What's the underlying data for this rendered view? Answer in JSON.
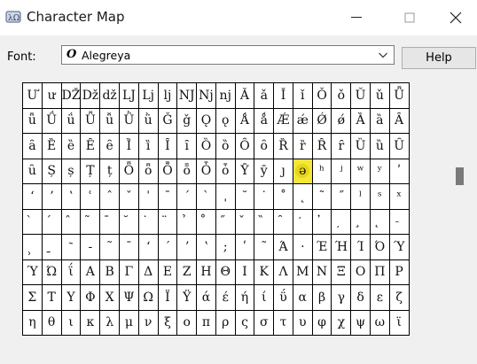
{
  "window": {
    "title": "Character Map"
  },
  "font": {
    "label": "Font:",
    "value": "Alegreya",
    "glyph": "O"
  },
  "help_label": "Help",
  "grid": {
    "rows": [
      [
        "Ư",
        "ư",
        "DŽ",
        "Dž",
        "dž",
        "LJ",
        "Lj",
        "lj",
        "NJ",
        "Nj",
        "nj",
        "Ǎ",
        "ǎ",
        "Ǐ",
        "ǐ",
        "Ǒ",
        "ǒ",
        "Ǔ",
        "ǔ",
        "Ǖ"
      ],
      [
        "ǖ",
        "Ǘ",
        "ǘ",
        "Ǚ",
        "ǚ",
        "Ǜ",
        "ǜ",
        "Ǧ",
        "ǧ",
        "Ǫ",
        "ǫ",
        "Ǻ",
        "ǻ",
        "Ǽ",
        "ǽ",
        "Ǿ",
        "ǿ",
        "Ȁ",
        "ȁ",
        "Ȃ"
      ],
      [
        "ȃ",
        "Ȅ",
        "ȅ",
        "Ȇ",
        "ȇ",
        "Ȉ",
        "ȉ",
        "Ȋ",
        "ȋ",
        "Ȍ",
        "ȍ",
        "Ȏ",
        "ȏ",
        "Ȑ",
        "ȑ",
        "Ȓ",
        "ȓ",
        "Ȕ",
        "ȕ",
        "Ȗ"
      ],
      [
        "ȗ",
        "Ș",
        "ș",
        "Ț",
        "ț",
        "Ȫ",
        "ȫ",
        "Ȭ",
        "ȭ",
        "Ȱ",
        "ȱ",
        "Ȳ",
        "ȳ",
        "ȷ",
        "ə",
        "ʰ",
        "ʲ",
        "ʷ",
        "ʸ",
        "ʹ"
      ],
      [
        "ʻ",
        "ʼ",
        "ʽ",
        "ʿ",
        "ˆ",
        "ˇ",
        "ˈ",
        "ˉ",
        "ˊ",
        "ˋ",
        "ˌ",
        "˘",
        "˙",
        "˚",
        "˛",
        "˜",
        "˝",
        "ˡ",
        "ˢ",
        "ˣ"
      ],
      [
        "̀",
        "́",
        "̂",
        "̃",
        "̄",
        "̆",
        "̇",
        "̈",
        "̉",
        "̊",
        "̋",
        "̌",
        "̏",
        "̑",
        "̒",
        "̓",
        "̦",
        "̧",
        "̨",
        "̵"
      ],
      [
        "̹",
        "̱",
        "͂",
        "‐",
        "˜",
        "ˉ",
        "ʻ",
        "ˊ",
        "ʼ",
        "ʽ",
        ";",
        "ʹ",
        "˜",
        "Ά",
        "·",
        "Έ",
        "Ή",
        "Ί",
        "Ό",
        "Ύ"
      ],
      [
        "Ύ",
        "Ώ",
        "ΐ",
        "Α",
        "Β",
        "Γ",
        "Δ",
        "Ε",
        "Ζ",
        "Η",
        "Θ",
        "Ι",
        "Κ",
        "Λ",
        "Μ",
        "Ν",
        "Ξ",
        "Ο",
        "Π",
        "Ρ"
      ],
      [
        "Σ",
        "Τ",
        "Υ",
        "Φ",
        "Χ",
        "Ψ",
        "Ω",
        "Ϊ",
        "Ϋ",
        "ά",
        "έ",
        "ή",
        "ί",
        "ΰ",
        "α",
        "β",
        "γ",
        "δ",
        "ε",
        "ζ"
      ],
      [
        "η",
        "θ",
        "ι",
        "κ",
        "λ",
        "μ",
        "ν",
        "ξ",
        "ο",
        "π",
        "ρ",
        "ς",
        "σ",
        "τ",
        "υ",
        "φ",
        "χ",
        "ψ",
        "ω",
        "ϊ"
      ]
    ],
    "selected": [
      3,
      14
    ]
  },
  "accent_color": "#f4e63a"
}
